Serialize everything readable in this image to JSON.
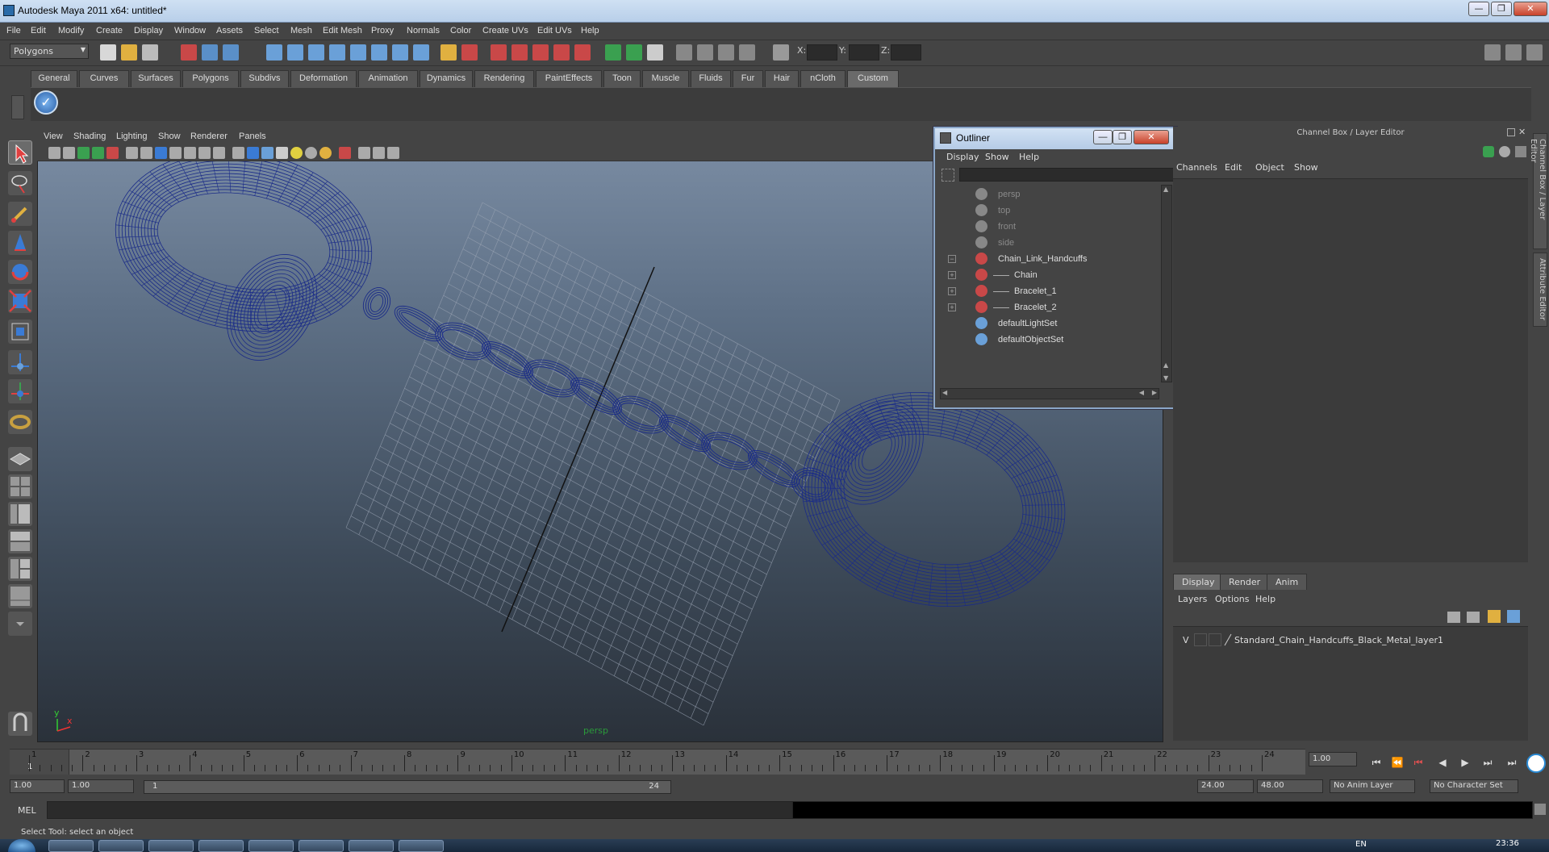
{
  "window": {
    "title": "Autodesk Maya 2011 x64: untitled*",
    "min": "—",
    "max": "❐",
    "close": "✕"
  },
  "menubar": [
    "File",
    "Edit",
    "Modify",
    "Create",
    "Display",
    "Window",
    "Assets",
    "Select",
    "Mesh",
    "Edit Mesh",
    "Proxy",
    "Normals",
    "Color",
    "Create UVs",
    "Edit UVs",
    "Help"
  ],
  "statusline": {
    "mode": "Polygons",
    "x_label": "X:",
    "y_label": "Y:",
    "z_label": "Z:"
  },
  "shelf_tabs": [
    "General",
    "Curves",
    "Surfaces",
    "Polygons",
    "Subdivs",
    "Deformation",
    "Animation",
    "Dynamics",
    "Rendering",
    "PaintEffects",
    "Toon",
    "Muscle",
    "Fluids",
    "Fur",
    "Hair",
    "nCloth",
    "Custom"
  ],
  "shelf_active": "Custom",
  "viewport": {
    "menu": [
      "View",
      "Shading",
      "Lighting",
      "Show",
      "Renderer",
      "Panels"
    ],
    "camera": "persp",
    "axis_y": "y",
    "axis_x": "x",
    "wire_color": "#1a2b88"
  },
  "outliner": {
    "title": "Outliner",
    "menu": [
      "Display",
      "Show",
      "Help"
    ],
    "items": [
      {
        "label": "persp",
        "dim": true
      },
      {
        "label": "top",
        "dim": true
      },
      {
        "label": "front",
        "dim": true
      },
      {
        "label": "side",
        "dim": true
      },
      {
        "label": "Chain_Link_Handcuffs",
        "dim": false,
        "expander": "−"
      },
      {
        "label": "Chain",
        "dim": false,
        "expander": "+"
      },
      {
        "label": "Bracelet_1",
        "dim": false,
        "expander": "+"
      },
      {
        "label": "Bracelet_2",
        "dim": false,
        "expander": "+"
      },
      {
        "label": "defaultLightSet",
        "dim": false
      },
      {
        "label": "defaultObjectSet",
        "dim": false
      }
    ]
  },
  "channelbox": {
    "header": "Channel Box / Layer Editor",
    "menu": [
      "Channels",
      "Edit",
      "Object",
      "Show"
    ]
  },
  "side_tabs": [
    "Channel Box / Layer Editor",
    "Attribute Editor"
  ],
  "layer_editor": {
    "tabs": [
      "Display",
      "Render",
      "Anim"
    ],
    "menu": [
      "Layers",
      "Options",
      "Help"
    ],
    "layer": {
      "visible": "V",
      "name": "Standard_Chain_Handcuffs_Black_Metal_layer1"
    }
  },
  "timeslider": {
    "ticks": [
      "1",
      "2",
      "3",
      "4",
      "5",
      "6",
      "7",
      "8",
      "9",
      "10",
      "11",
      "12",
      "13",
      "14",
      "15",
      "16",
      "17",
      "18",
      "19",
      "20",
      "21",
      "22",
      "23",
      "24"
    ],
    "current_frame": "1",
    "current_time": "1.00"
  },
  "range": {
    "start": "1.00",
    "anim_start": "1.00",
    "range_start": "1",
    "range_end": "24",
    "anim_end": "24.00",
    "end": "48.00",
    "anim_layer": "No Anim Layer",
    "char_set": "No Character Set"
  },
  "cmdline": {
    "label": "MEL"
  },
  "helpline": "Select Tool: select an object",
  "taskbar": {
    "lang": "EN",
    "time": "23:36"
  }
}
